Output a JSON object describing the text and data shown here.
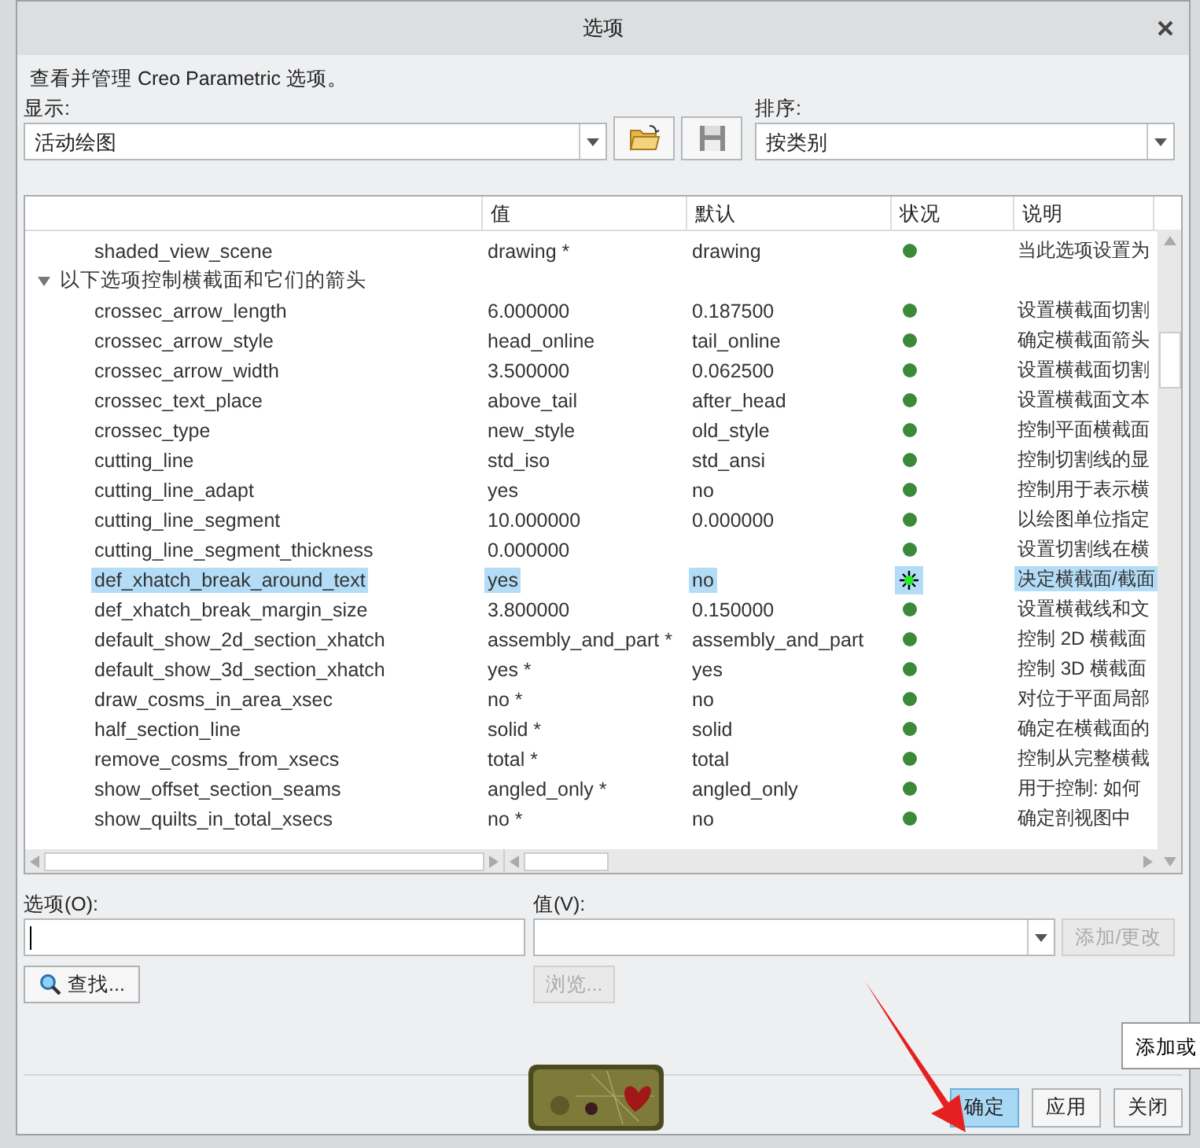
{
  "window": {
    "title": "选项"
  },
  "intro": "查看并管理 Creo Parametric 选项。",
  "display": {
    "label": "显示:",
    "value": "活动绘图"
  },
  "sort": {
    "label": "排序:",
    "value": "按类别"
  },
  "table": {
    "columns": [
      "值",
      "默认",
      "状况",
      "说明"
    ],
    "rows": [
      {
        "kind": "option",
        "name": "shaded_view_scene",
        "value": "drawing *",
        "default": "drawing",
        "description": "当此选项设置为",
        "selected": false
      },
      {
        "kind": "group",
        "name": "以下选项控制横截面和它们的箭头",
        "expanded": true
      },
      {
        "kind": "option",
        "name": "crossec_arrow_length",
        "value": "6.000000",
        "default": "0.187500",
        "description": "设置横截面切割",
        "selected": false
      },
      {
        "kind": "option",
        "name": "crossec_arrow_style",
        "value": "head_online",
        "default": "tail_online",
        "description": "确定横截面箭头",
        "selected": false
      },
      {
        "kind": "option",
        "name": "crossec_arrow_width",
        "value": "3.500000",
        "default": "0.062500",
        "description": "设置横截面切割",
        "selected": false
      },
      {
        "kind": "option",
        "name": "crossec_text_place",
        "value": "above_tail",
        "default": "after_head",
        "description": "设置横截面文本",
        "selected": false
      },
      {
        "kind": "option",
        "name": "crossec_type",
        "value": "new_style",
        "default": "old_style",
        "description": "控制平面横截面",
        "selected": false
      },
      {
        "kind": "option",
        "name": "cutting_line",
        "value": "std_iso",
        "default": "std_ansi",
        "description": "控制切割线的显",
        "selected": false
      },
      {
        "kind": "option",
        "name": "cutting_line_adapt",
        "value": "yes",
        "default": "no",
        "description": "控制用于表示横",
        "selected": false
      },
      {
        "kind": "option",
        "name": "cutting_line_segment",
        "value": "10.000000",
        "default": "0.000000",
        "description": "以绘图单位指定",
        "selected": false
      },
      {
        "kind": "option",
        "name": "cutting_line_segment_thickness",
        "value": "0.000000",
        "description": "设置切割线在横",
        "selected": false
      },
      {
        "kind": "option",
        "name": "def_xhatch_break_around_text",
        "value": "yes",
        "default": "no",
        "description": "决定横截面/截面",
        "selected": true
      },
      {
        "kind": "option",
        "name": "def_xhatch_break_margin_size",
        "value": "3.800000",
        "default": "0.150000",
        "description": "设置横截线和文",
        "selected": false
      },
      {
        "kind": "option",
        "name": "default_show_2d_section_xhatch",
        "value": "assembly_and_part *",
        "default": "assembly_and_part",
        "description": "控制 2D 横截面",
        "selected": false
      },
      {
        "kind": "option",
        "name": "default_show_3d_section_xhatch",
        "value": "yes *",
        "default": "yes",
        "description": "控制 3D 横截面",
        "selected": false
      },
      {
        "kind": "option",
        "name": "draw_cosms_in_area_xsec",
        "value": "no *",
        "default": "no",
        "description": "对位于平面局部",
        "selected": false
      },
      {
        "kind": "option",
        "name": "half_section_line",
        "value": "solid *",
        "default": "solid",
        "description": "确定在横截面的",
        "selected": false
      },
      {
        "kind": "option",
        "name": "remove_cosms_from_xsecs",
        "value": "total *",
        "default": "total",
        "description": "控制从完整横截",
        "selected": false
      },
      {
        "kind": "option",
        "name": "show_offset_section_seams",
        "value": "angled_only *",
        "default": "angled_only",
        "description": "用于控制: 如何",
        "selected": false
      },
      {
        "kind": "option",
        "name": "show_quilts_in_total_xsecs",
        "value": "no *",
        "default": "no",
        "description": "确定剖视图中",
        "selected": false
      }
    ]
  },
  "option_field": {
    "label": "选项(O):"
  },
  "value_field": {
    "label": "值(V):"
  },
  "buttons": {
    "add_change": {
      "label": "添加/更改",
      "disabled": true
    },
    "find": {
      "label": "查找...",
      "disabled": false
    },
    "browse": {
      "label": "浏览...",
      "disabled": true
    }
  },
  "tooltip": "添加或",
  "footer_buttons": [
    {
      "label": "确定",
      "selected": true
    },
    {
      "label": "应用",
      "selected": false
    },
    {
      "label": "关闭",
      "selected": false
    }
  ]
}
